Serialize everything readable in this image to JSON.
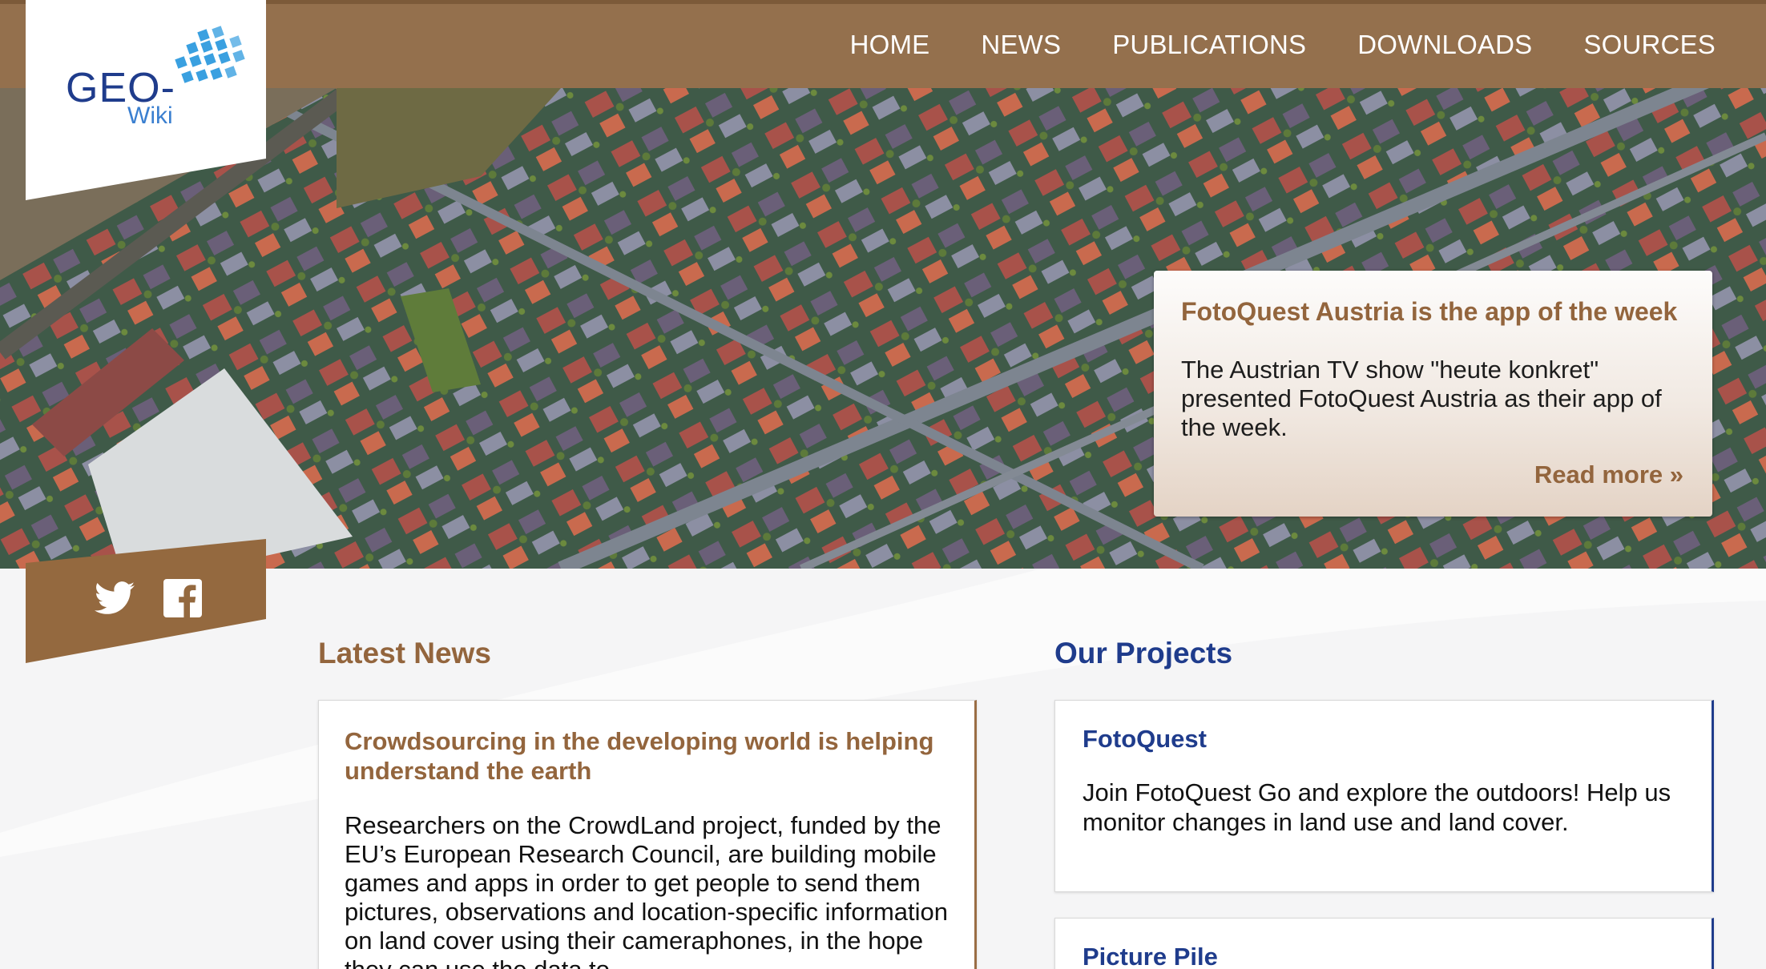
{
  "logo": {
    "geo": "GEO-",
    "wiki": "Wiki"
  },
  "nav": {
    "items": [
      {
        "label": "HOME"
      },
      {
        "label": "NEWS"
      },
      {
        "label": "PUBLICATIONS"
      },
      {
        "label": "DOWNLOADS"
      },
      {
        "label": "SOURCES"
      }
    ]
  },
  "feature": {
    "title": "FotoQuest Austria is the app of the week",
    "body": "The Austrian TV show \"heute konkret\" presented FotoQuest Austria as their app of the week.",
    "link": "Read more »"
  },
  "social": {
    "icons": [
      "twitter-icon",
      "facebook-icon"
    ]
  },
  "latest_news": {
    "heading": "Latest News",
    "card": {
      "title": "Crowdsourcing in the developing world is helping understand the earth",
      "body": "Researchers on the CrowdLand project, funded by the EU’s European Research Council, are building mobile games and apps in order to get people to send them pictures, observations and location-specific information on land cover using their cameraphones, in the hope they can use the data to"
    }
  },
  "projects": {
    "heading": "Our Projects",
    "items": [
      {
        "title": "FotoQuest",
        "body": "Join FotoQuest Go and explore the outdoors! Help us monitor changes in land use and land cover."
      },
      {
        "title": "Picture Pile",
        "body": ""
      }
    ]
  },
  "colors": {
    "brand_brown": "#94704d",
    "heading_brown": "#93653d",
    "brand_blue": "#1f3c8c"
  }
}
